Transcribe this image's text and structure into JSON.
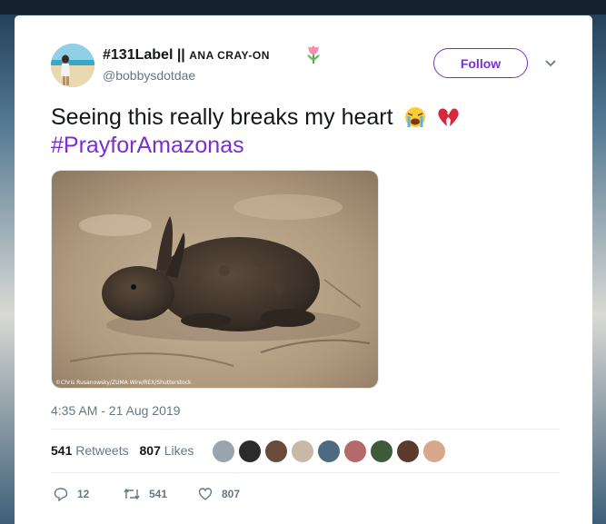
{
  "tweet": {
    "display_name": "#131Label ||",
    "display_name_tag": "ANA CRAY-ON",
    "handle": "@bobbysdotdae",
    "follow_label": "Follow",
    "text_line1": "Seeing this really breaks my heart",
    "hashtag": "#PrayforAmazonas",
    "photo_credit": "©Chris Rusanowsky/ZUMA Wire/REX/Shutterstock",
    "timestamp": "4:35 AM - 21 Aug 2019",
    "retweets_count": "541",
    "retweets_label": "Retweets",
    "likes_count": "807",
    "likes_label": "Likes",
    "actions": {
      "reply_count": "12",
      "retweet_count": "541",
      "like_count": "807"
    }
  },
  "icons": {
    "name_emoji": "tulip-icon",
    "text_emojis": [
      "loudly-crying-face-icon",
      "broken-heart-icon"
    ],
    "caret": "chevron-down-icon",
    "reply": "reply-icon",
    "retweet": "retweet-icon",
    "like": "heart-icon"
  },
  "colors": {
    "accent": "#7b2fcf",
    "text": "#14171a",
    "secondary_text": "#657786",
    "border": "#e6ecf0"
  }
}
